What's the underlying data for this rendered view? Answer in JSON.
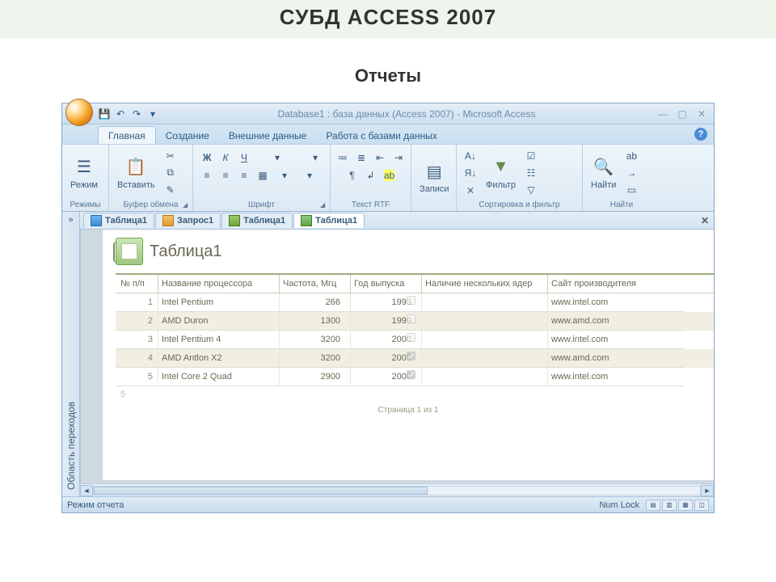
{
  "slide": {
    "title": "СУБД ACCESS 2007",
    "subtitle": "Отчеты"
  },
  "window": {
    "title": "Database1 : база данных (Access 2007)  -  Microsoft Access"
  },
  "qat": {
    "save": "💾",
    "undo": "↶",
    "redo": "↷",
    "dropdown": "▾"
  },
  "tabs": {
    "home": "Главная",
    "create": "Создание",
    "external": "Внешние данные",
    "dbtools": "Работа с базами данных"
  },
  "ribbon": {
    "views_group": "Режимы",
    "view_btn": "Режим",
    "clipboard_group": "Буфер обмена",
    "paste_btn": "Вставить",
    "font_group": "Шрифт",
    "richtext_group": "Текст RTF",
    "records_group": "",
    "records_btn": "Записи",
    "sortfilter_group": "Сортировка и фильтр",
    "filter_btn": "Фильтр",
    "find_group": "Найти",
    "find_btn": "Найти"
  },
  "nav_pane": {
    "toggle": "»",
    "label": "Область переходов"
  },
  "doc_tabs": [
    {
      "label": "Таблица1",
      "icon": "table"
    },
    {
      "label": "Запрос1",
      "icon": "query"
    },
    {
      "label": "Таблица1",
      "icon": "table2"
    },
    {
      "label": "Таблица1",
      "icon": "report",
      "active": true
    }
  ],
  "report": {
    "title": "Таблица1",
    "columns": {
      "c1": "№ п/п",
      "c2": "Название процессора",
      "c3": "Частота, Мгц",
      "c4": "Год выпуска",
      "c5": "Наличие нескольких ядер",
      "c6": "Сайт производителя"
    },
    "rows": [
      {
        "n": "1",
        "name": "Intel Pentium",
        "freq": "266",
        "year": "1993",
        "multi": false,
        "site": "www.intel.com"
      },
      {
        "n": "2",
        "name": "AMD Duron",
        "freq": "1300",
        "year": "1999",
        "multi": false,
        "site": "www.amd.com"
      },
      {
        "n": "3",
        "name": "Intel Pentium 4",
        "freq": "3200",
        "year": "2000",
        "multi": false,
        "site": "www.intel.com"
      },
      {
        "n": "4",
        "name": "AMD Antlon X2",
        "freq": "3200",
        "year": "2005",
        "multi": true,
        "site": "www.amd.com"
      },
      {
        "n": "5",
        "name": "Intel Core 2 Quad",
        "freq": "2900",
        "year": "2008",
        "multi": true,
        "site": "www.intel.com"
      }
    ],
    "trailing_count": "5",
    "footer": "Страница 1 из 1"
  },
  "status": {
    "mode": "Режим отчета",
    "numlock": "Num Lock"
  }
}
